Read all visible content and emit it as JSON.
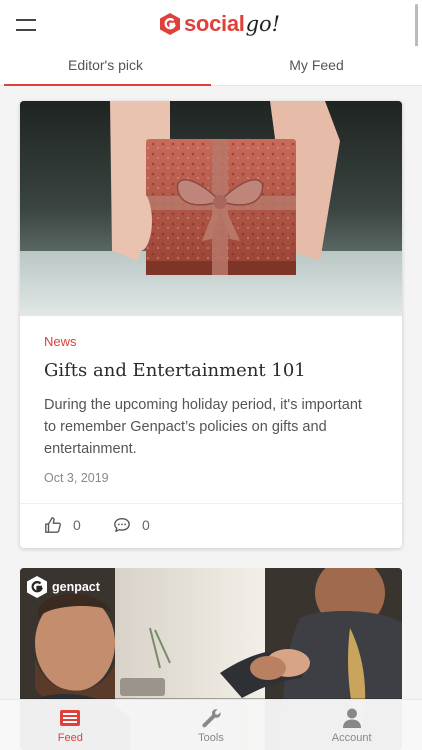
{
  "header": {
    "logo_text": "social",
    "logo_suffix": "go!",
    "menu_icon": "hamburger-icon"
  },
  "tabs": [
    {
      "label": "Editor's pick",
      "active": true
    },
    {
      "label": "My Feed",
      "active": false
    }
  ],
  "feed": [
    {
      "category": "News",
      "title": "Gifts and Entertainment 101",
      "summary": "During the upcoming holiday period, it's important to remember Genpact’s policies on gifts and entertainment.",
      "date": "Oct 3, 2019",
      "likes": "0",
      "comments": "0",
      "image": "gift-box-photo"
    },
    {
      "brand": "genpact",
      "image": "handshake-photo"
    }
  ],
  "bottom_nav": [
    {
      "label": "Feed",
      "icon": "feed-icon",
      "active": true
    },
    {
      "label": "Tools",
      "icon": "wrench-icon",
      "active": false
    },
    {
      "label": "Account",
      "icon": "person-icon",
      "active": false
    }
  ],
  "colors": {
    "accent": "#e0403a",
    "text": "#2b2b2b",
    "muted": "#888888"
  }
}
